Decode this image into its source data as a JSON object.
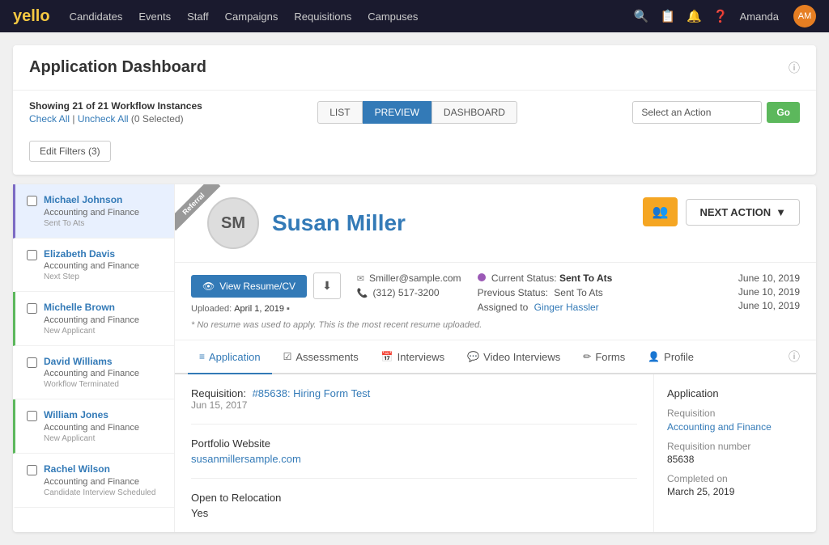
{
  "topNav": {
    "logo": "yello",
    "items": [
      "Candidates",
      "Events",
      "Staff",
      "Campaigns",
      "Requisitions",
      "Campuses"
    ],
    "userName": "Amanda"
  },
  "dashboard": {
    "title": "Application Dashboard",
    "showing": "Showing 21 of 21 Workflow Instances",
    "checkAll": "Check All",
    "uncheckAll": "Uncheck All",
    "selected": "(0 Selected)",
    "views": [
      "LIST",
      "PREVIEW",
      "DASHBOARD"
    ],
    "activeView": "PREVIEW",
    "actionSelect": "Select an Action",
    "goBtn": "Go",
    "filterBtn": "Edit Filters (3)"
  },
  "candidates": [
    {
      "name": "Michael Johnson",
      "dept": "Accounting and Finance",
      "status": "Sent To Ats",
      "active": true,
      "borderColor": "purple"
    },
    {
      "name": "Elizabeth Davis",
      "dept": "Accounting and Finance",
      "status": "Next Step",
      "active": false,
      "borderColor": "none"
    },
    {
      "name": "Michelle Brown",
      "dept": "Accounting and Finance",
      "status": "New Applicant",
      "active": false,
      "borderColor": "green"
    },
    {
      "name": "David Williams",
      "dept": "Accounting and Finance",
      "status": "Workflow Terminated",
      "active": false,
      "borderColor": "none"
    },
    {
      "name": "William Jones",
      "dept": "Accounting and Finance",
      "status": "New Applicant",
      "active": false,
      "borderColor": "green"
    },
    {
      "name": "Rachel Wilson",
      "dept": "Accounting and Finance",
      "status": "Candidate Interview Scheduled",
      "active": false,
      "borderColor": "none"
    }
  ],
  "candidateDetail": {
    "initials": "SM",
    "name": "Susan Miller",
    "ribbonLabel": "Referral",
    "resumeBtn": "View Resume/CV",
    "uploadedLabel": "Uploaded:",
    "uploadedDate": "April 1, 2019",
    "uploadedNote": "▪",
    "email": "Smiller@sample.com",
    "phone": "(312) 517-3200",
    "currentStatusLabel": "Current Status:",
    "currentStatus": "Sent To Ats",
    "prevStatusLabel": "Previous Status:",
    "prevStatus": "Sent To Ats",
    "assignedLabel": "Assigned to",
    "assignedTo": "Ginger Hassler",
    "date1": "June 10, 2019",
    "date2": "June 10, 2019",
    "date3": "June 10, 2019",
    "noResumeNote": "* No resume was used to apply. This is the most recent resume uploaded.",
    "nextActionBtn": "NEXT ACTION"
  },
  "tabs": [
    {
      "label": "Application",
      "icon": "≡",
      "active": true
    },
    {
      "label": "Assessments",
      "icon": "☑",
      "active": false
    },
    {
      "label": "Interviews",
      "icon": "📅",
      "active": false
    },
    {
      "label": "Video Interviews",
      "icon": "💬",
      "active": false
    },
    {
      "label": "Forms",
      "icon": "✏",
      "active": false
    },
    {
      "label": "Profile",
      "icon": "👤",
      "active": false
    }
  ],
  "applicationTab": {
    "reqLabel": "Requisition:",
    "reqLink": "#85638: Hiring Form Test",
    "reqDate": "Jun 15, 2017",
    "portfolioLabel": "Portfolio Website",
    "portfolioLink": "susanmillersample.com",
    "relocationLabel": "Open to Relocation",
    "relocationValue": "Yes"
  },
  "sidebar": {
    "sectionTitle": "Application",
    "fields": [
      {
        "label": "Requisition",
        "value": "Accounting and Finance",
        "isLink": true
      },
      {
        "label": "Requisition number",
        "value": "85638",
        "isLink": false
      },
      {
        "label": "Completed on",
        "value": "March 25, 2019",
        "isLink": false
      }
    ]
  }
}
